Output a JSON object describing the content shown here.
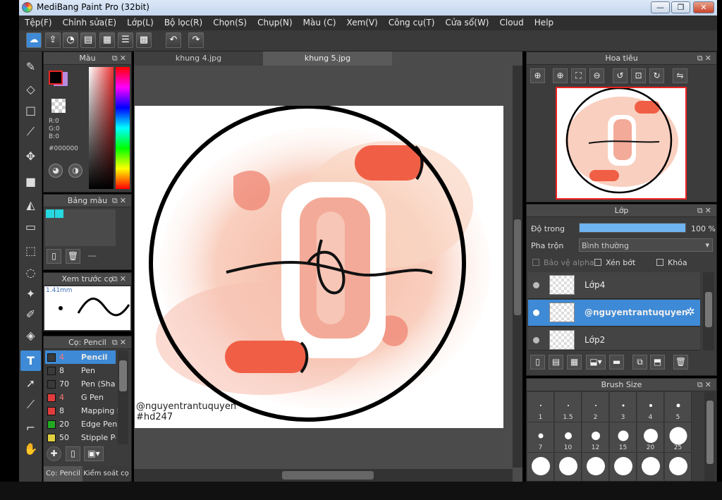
{
  "window": {
    "title": "MediBang Paint Pro (32bit)",
    "min": "—",
    "max": "❐",
    "close": "✕"
  },
  "menu": [
    "Tệp(F)",
    "Chỉnh sửa(E)",
    "Lớp(L)",
    "Bộ lọc(R)",
    "Chọn(S)",
    "Chụp(N)",
    "Màu (C)",
    "Xem(V)",
    "Công cụ(T)",
    "Cửa sổ(W)",
    "Cloud",
    "Help"
  ],
  "tabs": [
    "khung 4.jpg",
    "khung 5.jpg"
  ],
  "color_panel": {
    "title": "Màu",
    "r": "R:0",
    "g": "G:0",
    "b": "B:0",
    "hex": "#000000",
    "fg": "#000000",
    "bg": "#b88be0"
  },
  "palette_panel": {
    "title": "Bảng màu",
    "swatches": [
      "#26d8e0",
      "#26d8e0"
    ],
    "sep": "---"
  },
  "preview_panel": {
    "title": "Xem trước cọ",
    "size": "1.41mm"
  },
  "brush_panel": {
    "title": "Cọ: Pencil",
    "items": [
      {
        "size": "4",
        "name": "Pencil",
        "color": "#3a3a3a"
      },
      {
        "size": "8",
        "name": "Pen",
        "color": "#3a3a3a"
      },
      {
        "size": "70",
        "name": "Pen (Sha",
        "color": "#3a3a3a"
      },
      {
        "size": "4",
        "name": "G Pen",
        "color": "#e23c3c"
      },
      {
        "size": "8",
        "name": "Mapping I",
        "color": "#e23c3c"
      },
      {
        "size": "20",
        "name": "Edge Pen",
        "color": "#22aa22"
      },
      {
        "size": "50",
        "name": "Stipple Pe",
        "color": "#e0d040"
      }
    ],
    "tab1": "Cọ: Pencil",
    "tab2": "Kiểm soát cọ"
  },
  "navigator": {
    "title": "Hoa tiêu"
  },
  "layer_panel": {
    "title": "Lớp",
    "opacity_label": "Độ trong",
    "opacity_value": "100 %",
    "opacity_fraction": 1.0,
    "blend_label": "Pha trộn",
    "blend_value": "Bình thường",
    "protect_alpha": "Bảo vệ alpha",
    "clipping": "Xén bớt",
    "lock": "Khóa",
    "layers": [
      "Lớp4",
      "@nguyentrantuquyen",
      "Lớp2"
    ]
  },
  "brush_size": {
    "title": "Brush Size",
    "labels": [
      "1",
      "1.5",
      "2",
      "3",
      "4",
      "5",
      "7",
      "10",
      "12",
      "15",
      "20",
      "25",
      "",
      "",
      "",
      "",
      "",
      ""
    ]
  },
  "artwork": {
    "watermark_1": "@nguyentrantuquyen",
    "watermark_2": "#hd247"
  }
}
